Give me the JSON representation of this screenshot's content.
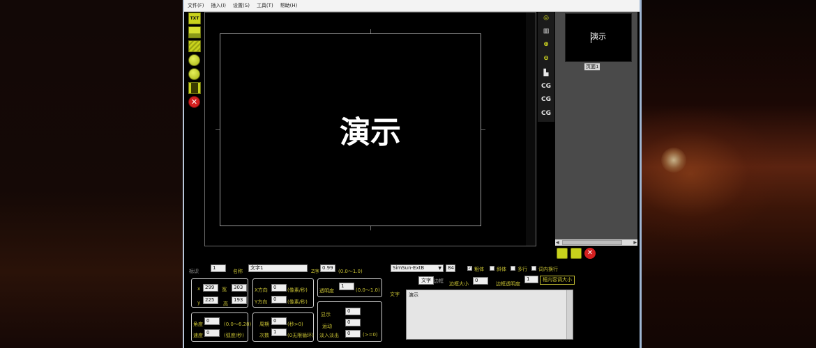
{
  "menu": [
    "文件(F)",
    "插入(I)",
    "设置(S)",
    "工具(T)",
    "帮助(H)"
  ],
  "left_toolbar": [
    {
      "icon": "text-insert-icon",
      "label": "TXT"
    },
    {
      "icon": "image-insert-icon",
      "label": ""
    },
    {
      "icon": "layers-icon",
      "label": ""
    },
    {
      "icon": "clock-icon",
      "label": ""
    },
    {
      "icon": "refresh-icon",
      "label": ""
    },
    {
      "icon": "film-icon",
      "label": ""
    },
    {
      "icon": "delete-icon",
      "label": "✕"
    }
  ],
  "canvas": {
    "text": "演示"
  },
  "right_toolbar": [
    {
      "icon": "target-icon",
      "label": "◎"
    },
    {
      "icon": "filmstrip-icon",
      "label": "▥"
    },
    {
      "icon": "zoom-in-icon",
      "label": "⊕"
    },
    {
      "icon": "zoom-out-icon",
      "label": "⊖"
    },
    {
      "icon": "boot-icon",
      "label": "▙"
    },
    {
      "icon": "cg-down-icon",
      "label": "CG"
    },
    {
      "icon": "cg-up-icon",
      "label": "CG"
    },
    {
      "icon": "cg-close-icon",
      "label": "CG"
    }
  ],
  "pages": {
    "thumb_text": "演示",
    "label": "页面1"
  },
  "props": {
    "id_label": "标识",
    "id_value": "1",
    "name_label": "名称",
    "name_value": "文字1",
    "z_label": "Z序",
    "z_value": "0.99",
    "z_range": "(0.0～1.0)",
    "x_label": "x",
    "x_value": "299",
    "w_label": "宽",
    "w_value": "303",
    "y_label": "y",
    "y_value": "225",
    "h_label": "高",
    "h_value": "193",
    "xdir_label": "X方向",
    "xdir_value": "0",
    "xdir_unit": "(像素/秒)",
    "ydir_label": "Y方向",
    "ydir_value": "0",
    "ydir_unit": "(像素/秒)",
    "opacity_label": "透明度",
    "opacity_value": "1",
    "opacity_range": "(0.0～1.0)",
    "angle_label": "角度",
    "angle_value": "0",
    "angle_range": "(0.0～6.28)",
    "speed_label": "速度",
    "speed_value": "0",
    "speed_unit": "(弧度/秒)",
    "period_label": "周期",
    "period_value": "0",
    "period_unit": "(秒>0)",
    "count_label": "次数",
    "count_value": "1",
    "count_unit": "(0无限循环)",
    "show_label": "显示",
    "show_value": "0",
    "motion_label": "运动",
    "motion_value": "0",
    "fade_label": "淡入淡出",
    "fade_value": "0",
    "fade_unit": "(>=0)",
    "font_name": "SimSun-ExtB",
    "font_size": "84",
    "bold_label": "粗体",
    "italic_label": "斜体",
    "multiline_label": "多行",
    "wrap_label": "词内换行",
    "text_tab": "文字",
    "border_tab": "边框",
    "border_size_label": "边框大小",
    "border_size_value": "0",
    "border_opacity_label": "边框透明度",
    "border_opacity_value": "1",
    "fit_button": "框内容调大小",
    "text_label": "文字",
    "text_value": "演示"
  }
}
